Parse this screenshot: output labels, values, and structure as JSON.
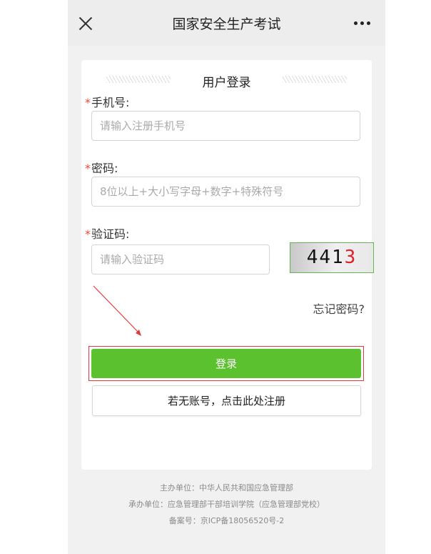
{
  "header": {
    "title": "国家安全生产考试",
    "close_icon": "close-icon",
    "more_icon": "more-dots-icon"
  },
  "card": {
    "title": "用户登录"
  },
  "phone_field": {
    "required_mark": "*",
    "label": "手机号:",
    "placeholder": "请输入注册手机号"
  },
  "password_field": {
    "required_mark": "*",
    "label": "密码:",
    "placeholder": "8位以上+大小写字母+数字+特殊符号"
  },
  "captcha_field": {
    "required_mark": "*",
    "label": "验证码:",
    "placeholder": "请输入验证码",
    "captcha_black": "441",
    "captcha_red": "3"
  },
  "forgot_link": "忘记密码?",
  "login_button": "登录",
  "register_button": "若无账号，点击此处注册",
  "footer": {
    "sponsor": "主办单位：中华人民共和国应急管理部",
    "organizer": "承办单位：应急管理部干部培训学院（应急管理部党校）",
    "icp": "备案号：京ICP备18056520号-2"
  },
  "colors": {
    "primary_green": "#5cc12f",
    "required_red": "#e8473b",
    "annotation_red": "#e13a3a"
  }
}
